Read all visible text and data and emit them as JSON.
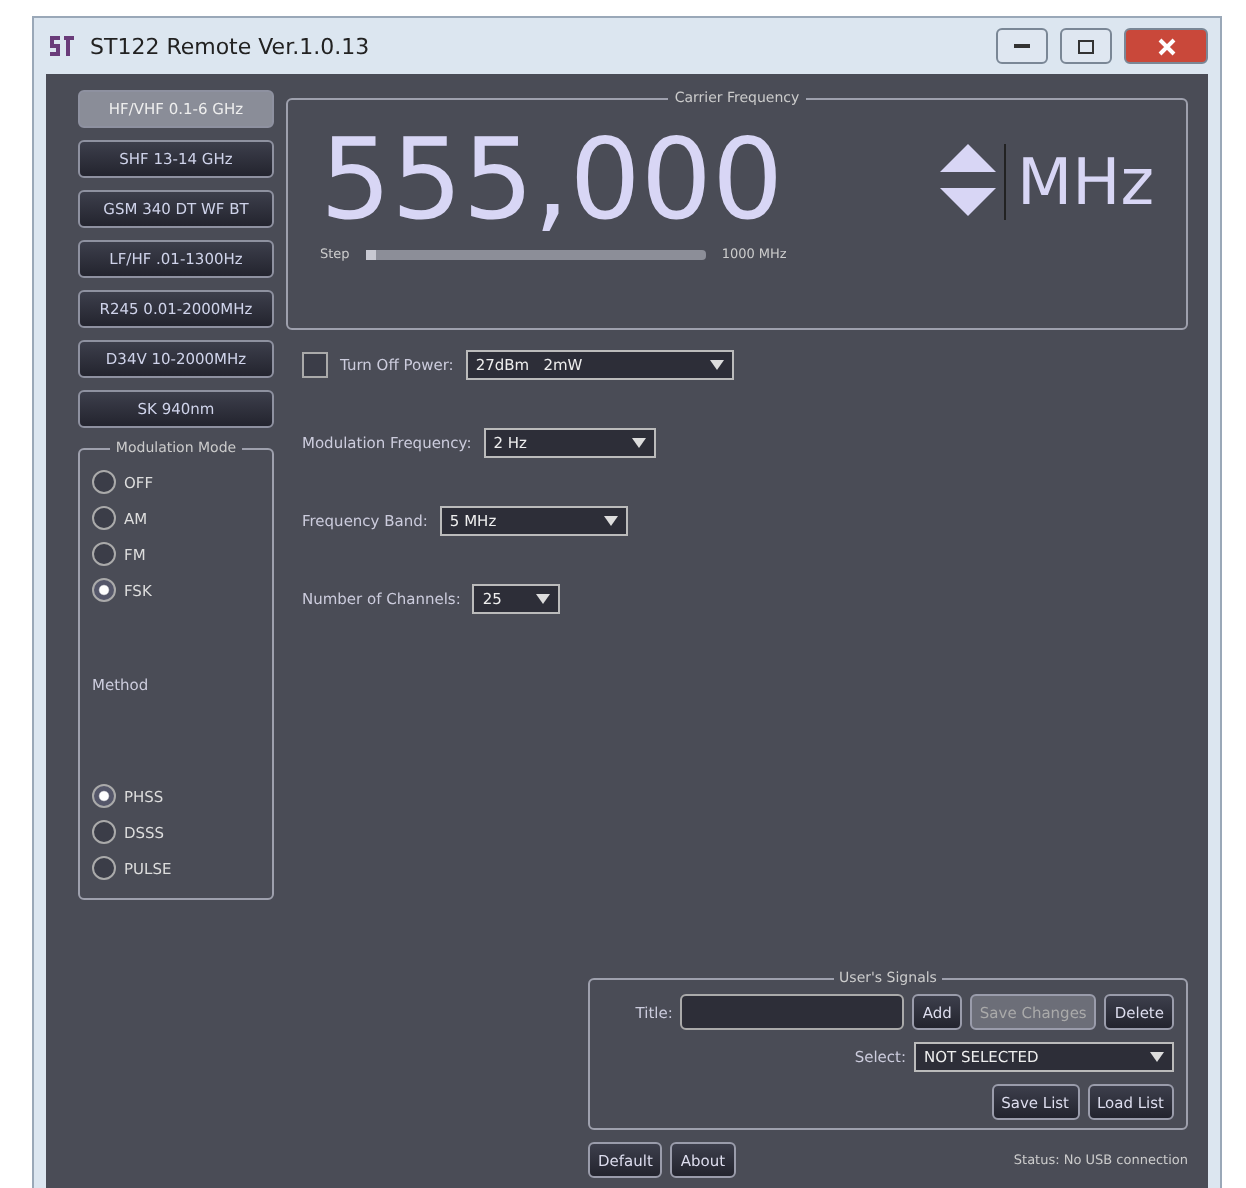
{
  "window": {
    "title": "ST122 Remote Ver.1.0.13"
  },
  "bands": [
    {
      "label": "HF/VHF 0.1-6 GHz",
      "selected": true
    },
    {
      "label": "SHF 13-14 GHz",
      "selected": false
    },
    {
      "label": "GSM 340 DT WF BT",
      "selected": false
    },
    {
      "label": "LF/HF .01-1300Hz",
      "selected": false
    },
    {
      "label": "R245 0.01-2000MHz",
      "selected": false
    },
    {
      "label": "D34V 10-2000MHz",
      "selected": false
    },
    {
      "label": "SK 940nm",
      "selected": false
    }
  ],
  "modulation_mode": {
    "title": "Modulation Mode",
    "options": [
      {
        "label": "OFF",
        "selected": false
      },
      {
        "label": "AM",
        "selected": false
      },
      {
        "label": "FM",
        "selected": false
      },
      {
        "label": "FSK",
        "selected": true
      }
    ],
    "method_label": "Method",
    "methods": [
      {
        "label": "PHSS",
        "selected": true
      },
      {
        "label": "DSSS",
        "selected": false
      },
      {
        "label": "PULSE",
        "selected": false
      }
    ]
  },
  "carrier": {
    "title": "Carrier Frequency",
    "value": "555,000",
    "unit": "MHz",
    "step_label": "Step",
    "level": 0.03,
    "step_reading": "1000 MHz"
  },
  "power": {
    "label": "Turn Off Power:",
    "checked": false,
    "value": "27dBm   2mW"
  },
  "fields": [
    {
      "label": "Modulation Frequency:",
      "value": "2 Hz"
    },
    {
      "label": "Frequency Band:",
      "value": "5 MHz"
    },
    {
      "label": "Number of Channels:",
      "value": "25"
    }
  ],
  "users_signals": {
    "title": "User's Signals",
    "title_label": "Title:",
    "buttons": [
      {
        "label": "Add",
        "disabled": false
      },
      {
        "label": "Save Changes",
        "disabled": true
      },
      {
        "label": "Delete",
        "disabled": false
      }
    ],
    "select_label": "Select:",
    "select_value": "NOT SELECTED",
    "list_buttons": [
      "Save List",
      "Load List"
    ]
  },
  "footer_buttons": [
    "Default",
    "About"
  ],
  "status": "Status: No USB connection"
}
